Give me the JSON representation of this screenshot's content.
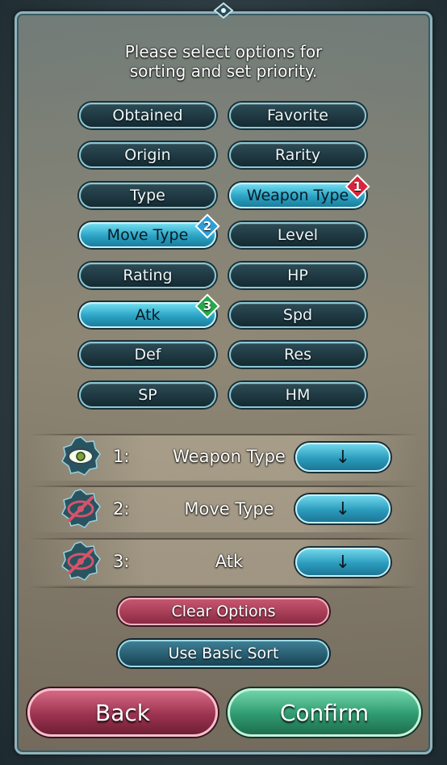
{
  "instructions": {
    "line1": "Please select options for",
    "line2": "sorting and set priority."
  },
  "options": [
    {
      "label": "Obtained",
      "selected": false
    },
    {
      "label": "Favorite",
      "selected": false
    },
    {
      "label": "Origin",
      "selected": false
    },
    {
      "label": "Rarity",
      "selected": false
    },
    {
      "label": "Type",
      "selected": false
    },
    {
      "label": "Weapon Type",
      "selected": true,
      "priority": "1"
    },
    {
      "label": "Move Type",
      "selected": true,
      "priority": "2"
    },
    {
      "label": "Level",
      "selected": false
    },
    {
      "label": "Rating",
      "selected": false
    },
    {
      "label": "HP",
      "selected": false
    },
    {
      "label": "Atk",
      "selected": true,
      "priority": "3"
    },
    {
      "label": "Spd",
      "selected": false
    },
    {
      "label": "Def",
      "selected": false
    },
    {
      "label": "Res",
      "selected": false
    },
    {
      "label": "SP",
      "selected": false
    },
    {
      "label": "HM",
      "selected": false
    }
  ],
  "badge_colors": {
    "1": "#d9243c",
    "2": "#2f9ed6",
    "3": "#27a84a"
  },
  "priorities": [
    {
      "number": "1:",
      "label": "Weapon Type",
      "direction": "↓",
      "icon": "eye-icon"
    },
    {
      "number": "2:",
      "label": "Move Type",
      "direction": "↓",
      "icon": "eye-slash-icon"
    },
    {
      "number": "3:",
      "label": "Atk",
      "direction": "↓",
      "icon": "eye-slash-icon"
    }
  ],
  "actions": {
    "clear": "Clear Options",
    "basic": "Use Basic Sort",
    "back": "Back",
    "confirm": "Confirm"
  }
}
